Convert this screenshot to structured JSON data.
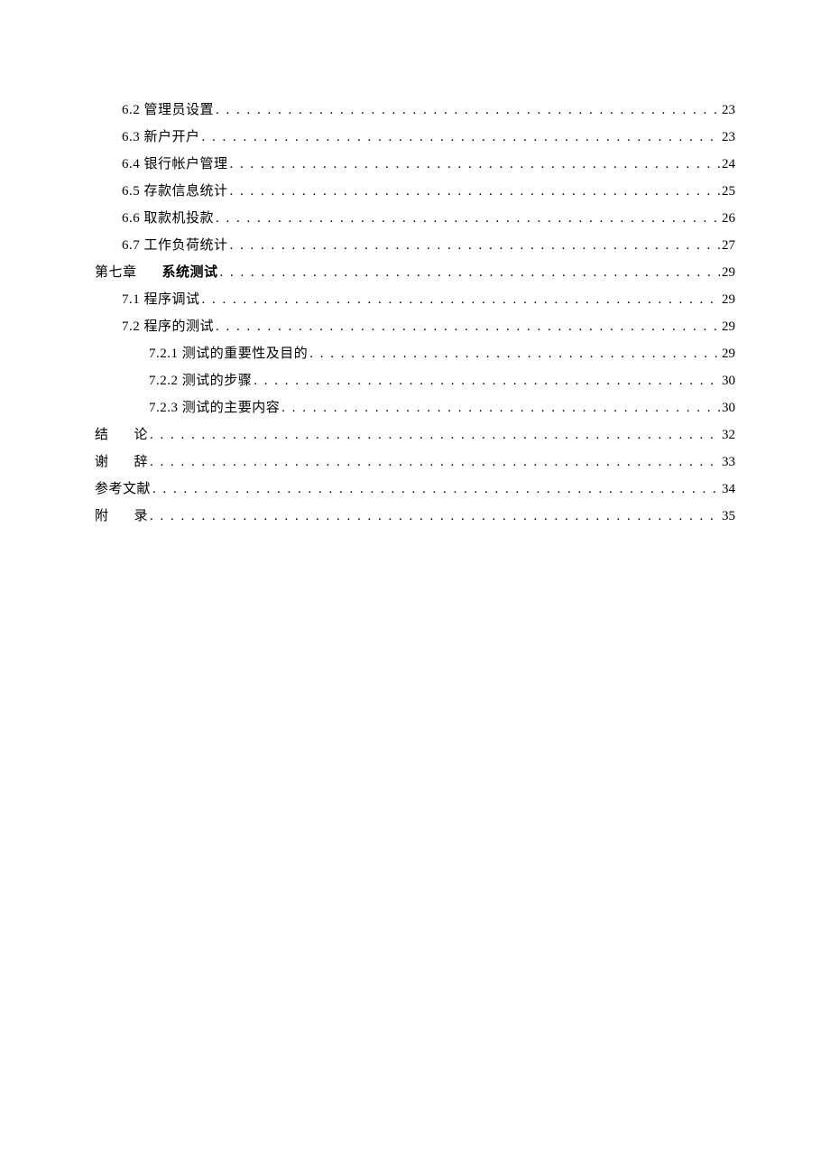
{
  "toc": {
    "entries": [
      {
        "indent": 1,
        "label": "6.2 管理员设置",
        "page": "23",
        "type": "plain"
      },
      {
        "indent": 1,
        "label": "6.3 新户开户",
        "page": "23",
        "type": "plain"
      },
      {
        "indent": 1,
        "label": "6.4 银行帐户管理",
        "page": "24",
        "type": "plain"
      },
      {
        "indent": 1,
        "label": "6.5 存款信息统计",
        "page": "25",
        "type": "plain"
      },
      {
        "indent": 1,
        "label": "6.6 取款机投款",
        "page": "26",
        "type": "plain"
      },
      {
        "indent": 1,
        "label": "6.7 工作负荷统计",
        "page": "27",
        "type": "plain"
      },
      {
        "indent": 0,
        "label_a": "第七章",
        "label_b": "系统测试",
        "page": "29",
        "type": "chapter"
      },
      {
        "indent": 1,
        "label": "7.1 程序调试",
        "page": "29",
        "type": "plain"
      },
      {
        "indent": 1,
        "label": "7.2 程序的测试",
        "page": "29",
        "type": "plain"
      },
      {
        "indent": 2,
        "label": "7.2.1 测试的重要性及目的",
        "page": "29",
        "type": "plain"
      },
      {
        "indent": 2,
        "label": "7.2.2 测试的步骤",
        "page": "30",
        "type": "plain"
      },
      {
        "indent": 2,
        "label": "7.2.3 测试的主要内容",
        "page": "30",
        "type": "plain"
      },
      {
        "indent": 0,
        "char1": "结",
        "char2": "论",
        "page": "32",
        "type": "spaced"
      },
      {
        "indent": 0,
        "char1": "谢",
        "char2": "辞",
        "page": "33",
        "type": "spaced"
      },
      {
        "indent": 0,
        "label": "参考文献",
        "page": "34",
        "type": "plain"
      },
      {
        "indent": 0,
        "char1": "附",
        "char2": "录",
        "page": "35",
        "type": "spaced"
      }
    ]
  }
}
